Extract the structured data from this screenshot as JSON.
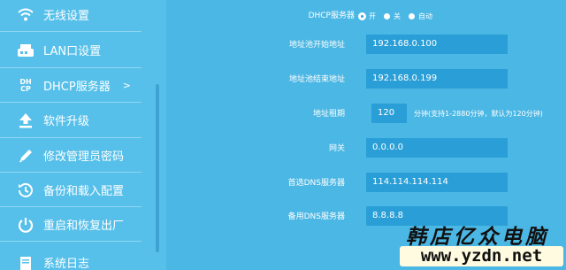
{
  "sidebar": {
    "items": [
      {
        "label": "无线设置",
        "icon": "wifi-icon"
      },
      {
        "label": "LAN口设置",
        "icon": "router-icon"
      },
      {
        "label": "DHCP服务器",
        "icon": "dhcp-icon",
        "icon_text": "DHCP",
        "active_arrow": ">"
      },
      {
        "label": "软件升级",
        "icon": "upload-icon"
      },
      {
        "label": "修改管理员密码",
        "icon": "pencil-icon"
      },
      {
        "label": "备份和载入配置",
        "icon": "history-icon"
      },
      {
        "label": "重启和恢复出厂",
        "icon": "power-icon"
      },
      {
        "label": "系统日志",
        "icon": "log-icon"
      }
    ]
  },
  "form": {
    "dhcp": {
      "label": "DHCP服务器",
      "options": [
        "开",
        "关",
        "自动"
      ],
      "selected": "开"
    },
    "start_ip": {
      "label": "地址池开始地址",
      "value": "192.168.0.100"
    },
    "end_ip": {
      "label": "地址池结束地址",
      "value": "192.168.0.199"
    },
    "lease": {
      "label": "地址租期",
      "value": "120",
      "hint": "分钟(支持1-2880分钟，默认为120分钟)"
    },
    "gateway": {
      "label": "网关",
      "value": "0.0.0.0"
    },
    "dns1": {
      "label": "首选DNS服务器",
      "value": "114.114.114.114"
    },
    "dns2": {
      "label": "备用DNS服务器",
      "value": "8.8.8.8"
    }
  },
  "watermark": {
    "line1": "韩店亿众电脑",
    "line2": "www.yzdn.net"
  },
  "colors": {
    "page_bg": "#4bb7e4",
    "sidebar_bg": "#56c0ea",
    "field_bg": "#2a9fd7"
  }
}
